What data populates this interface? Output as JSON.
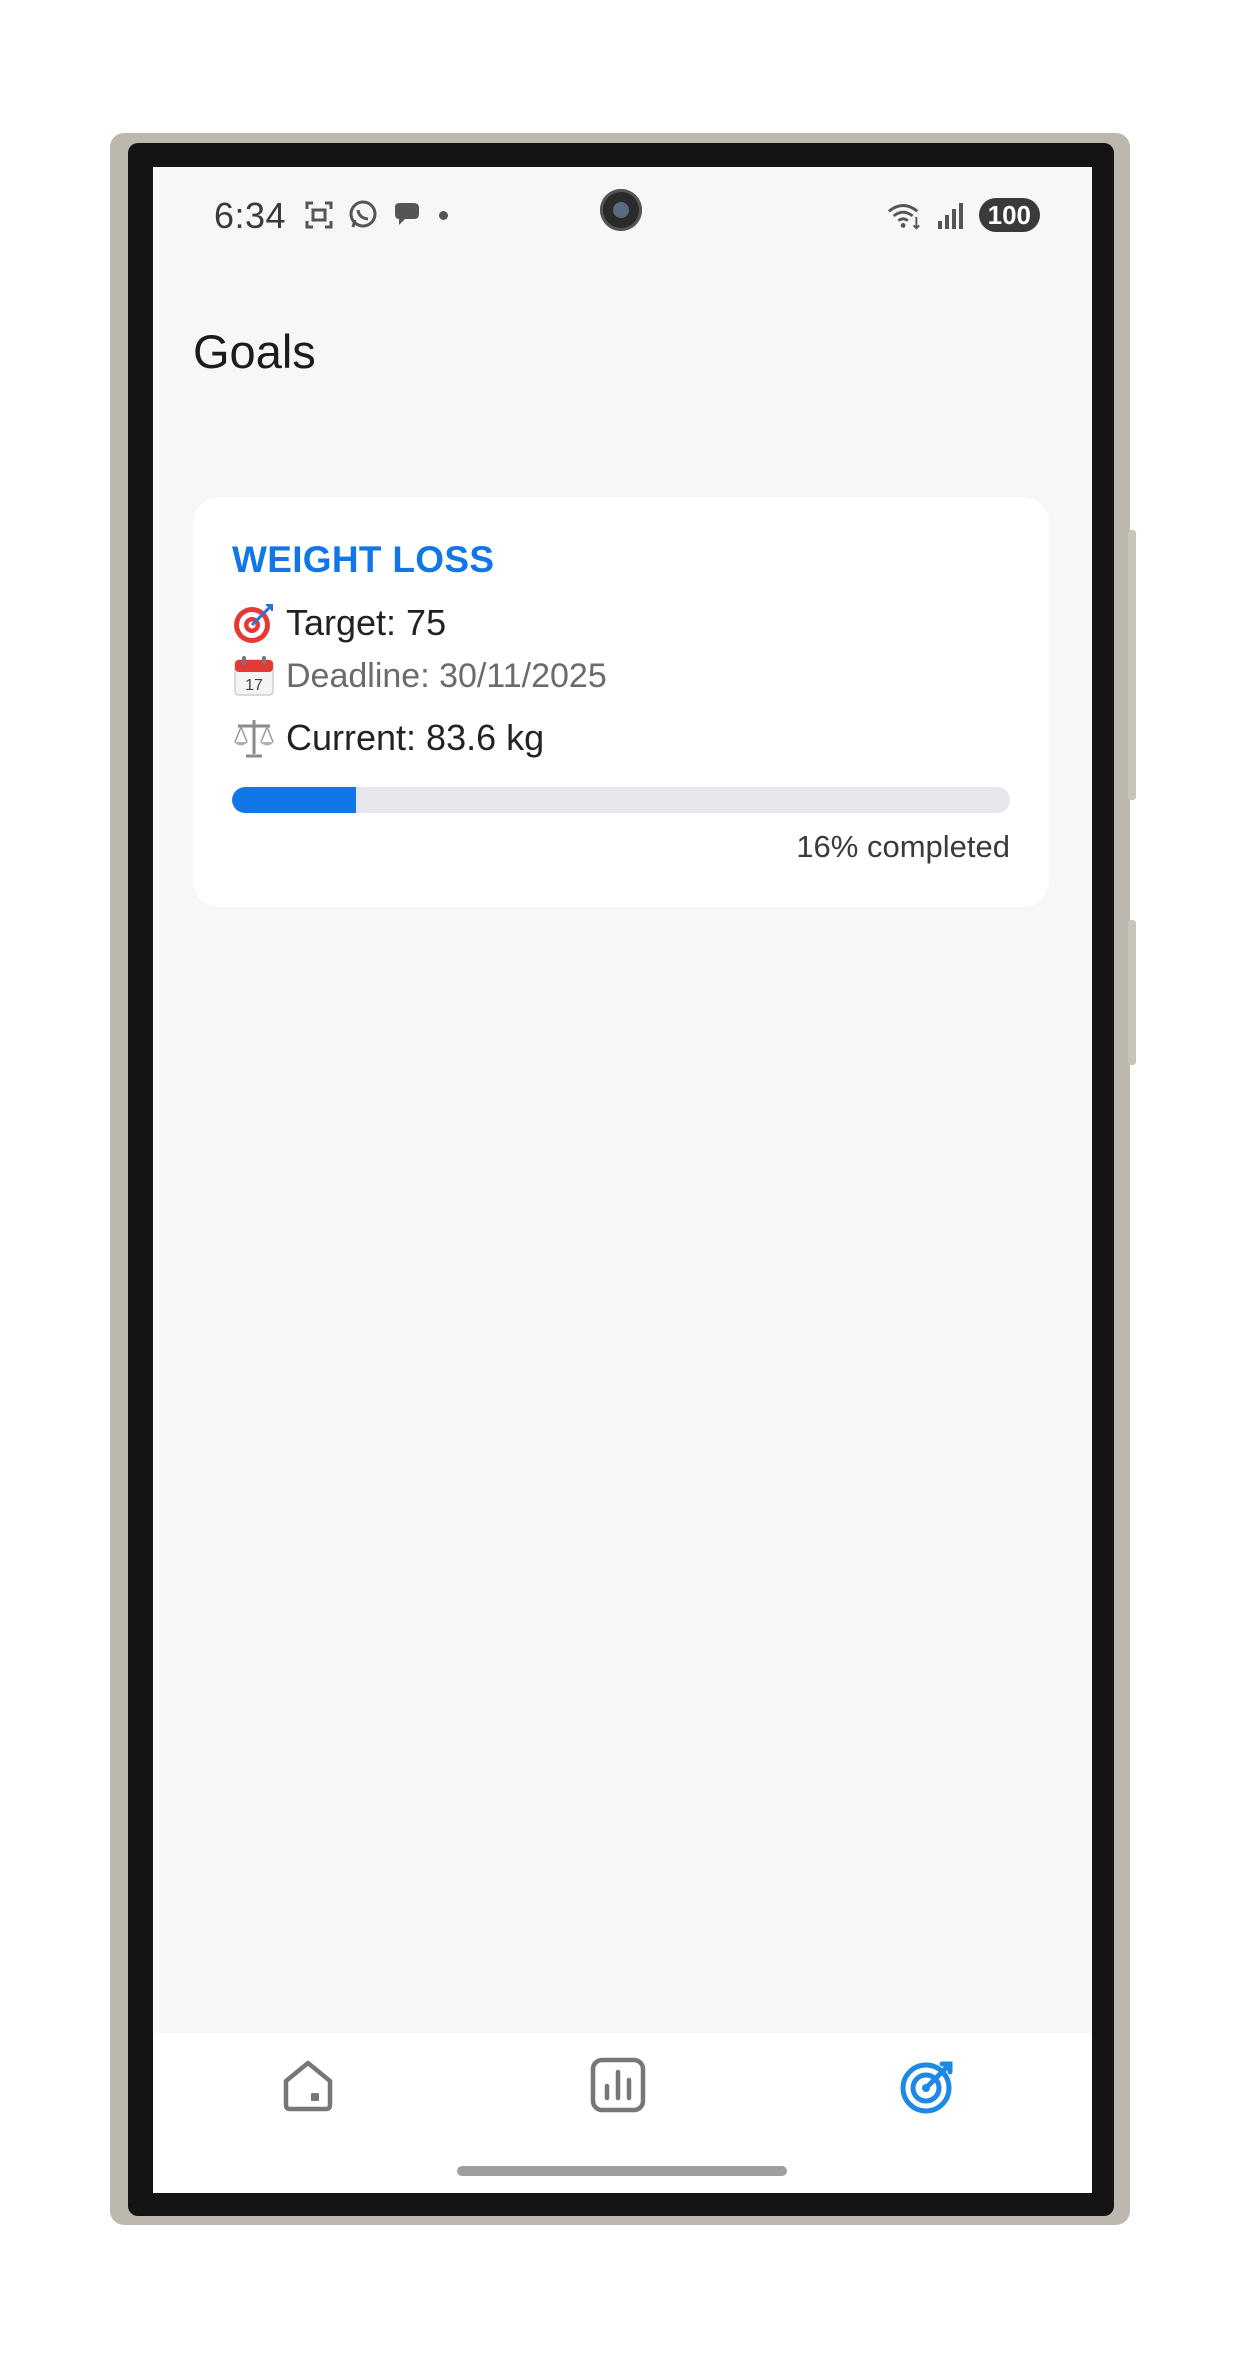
{
  "status_bar": {
    "time": "6:34",
    "battery": "100",
    "left_icons": [
      "screenshot-icon",
      "whatsapp-icon",
      "chat-icon",
      "notification-dot"
    ],
    "right_icons": [
      "wifi-icon",
      "signal-icon"
    ]
  },
  "page": {
    "title": "Goals"
  },
  "goal": {
    "title": "WEIGHT LOSS",
    "target_text": "Target: 75",
    "deadline_text": "Deadline: 30/11/2025",
    "current_text": "Current: 83.6 kg",
    "progress_percent": 16,
    "progress_label": "16% completed",
    "accent_color": "#1176e6"
  },
  "bottom_nav": {
    "items": [
      {
        "name": "home",
        "icon": "home-icon",
        "active": false
      },
      {
        "name": "stats",
        "icon": "bar-chart-icon",
        "active": false
      },
      {
        "name": "goals",
        "icon": "target-icon",
        "active": true
      }
    ]
  }
}
